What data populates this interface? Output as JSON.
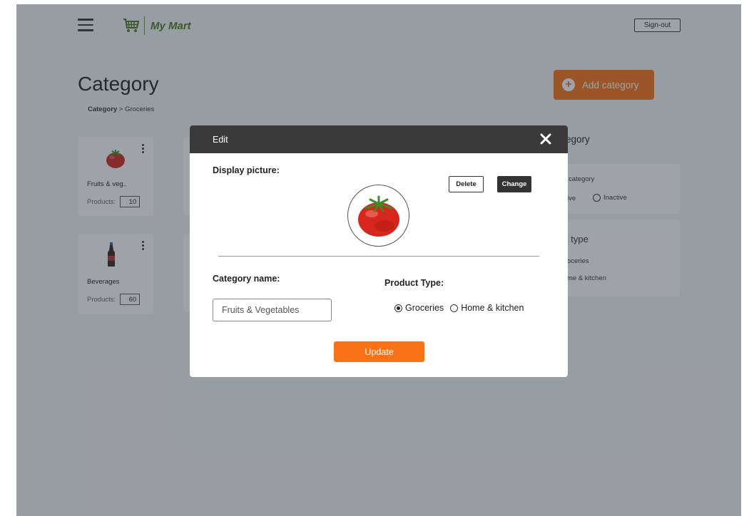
{
  "header": {
    "app_name": "My Mart",
    "signout_label": "Sign-out"
  },
  "page": {
    "title": "Category",
    "breadcrumb": {
      "root": "Category",
      "separator": ">",
      "current": "Groceries"
    },
    "add_button_label": "Add category"
  },
  "cards": [
    {
      "name": "Fruits & veg..",
      "products_label": "Products:",
      "count": "10",
      "icon": "tomato-icon"
    },
    {
      "name": "Beverages",
      "products_label": "Products:",
      "count": "60",
      "icon": "bottle-icon"
    }
  ],
  "right_panel": {
    "title_fragment": "egory",
    "status_label_fragment": "category",
    "active_fragment": "ive",
    "inactive_label": "Inactive",
    "type_title_fragment": "t type",
    "type_opt1_fragment": "oceries",
    "type_opt2_fragment": "me & kitchen"
  },
  "modal": {
    "title": "Edit",
    "display_picture_label": "Display picture:",
    "delete_label": "Delete",
    "change_label": "Change",
    "category_name_label": "Category name:",
    "category_name_value": "Fruits & Vegetables",
    "product_type_label": "Product Type:",
    "product_types": [
      {
        "label": "Groceries",
        "selected": true
      },
      {
        "label": "Home & kitchen",
        "selected": false
      }
    ],
    "update_label": "Update"
  },
  "colors": {
    "accent": "#f97316",
    "brand_green": "#4d7a1f",
    "modal_header": "#3a3a3a"
  }
}
